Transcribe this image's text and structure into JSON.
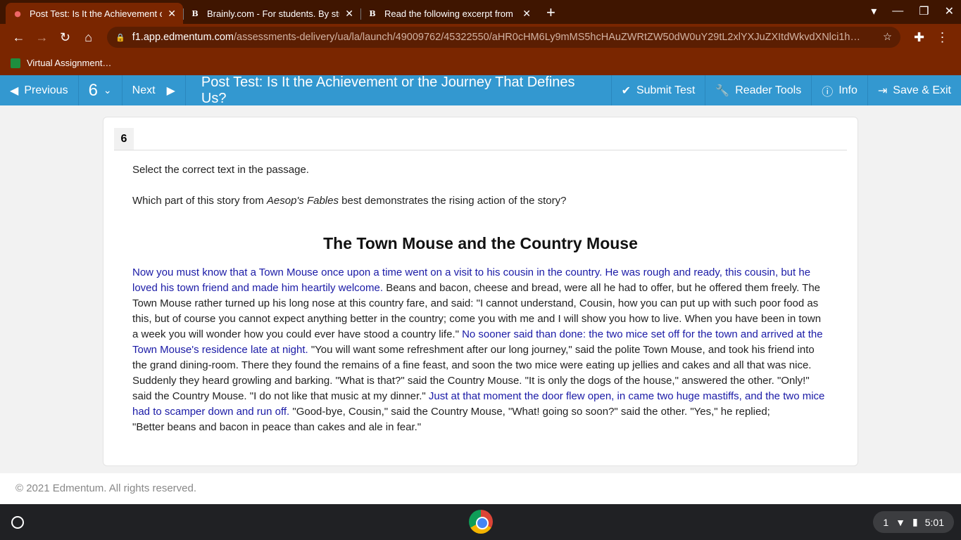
{
  "browser": {
    "tabs": [
      {
        "title": "Post Test: Is It the Achievement or the Journey That Defines Us?",
        "active": true,
        "favicon": "E"
      },
      {
        "title": "Brainly.com - For students. By students.",
        "favicon": "B"
      },
      {
        "title": "Read the following excerpt from",
        "favicon": "B"
      }
    ],
    "url_host": "f1.app.edmentum.com",
    "url_path": "/assessments-delivery/ua/la/launch/49009762/45322550/aHR0cHM6Ly9mMS5hcHAuZWRtZW50dW0uY29tL2xlYXJuZXItdWkvdXNlci1h…",
    "bookmark": "Virtual Assignment…"
  },
  "appbar": {
    "previous": "Previous",
    "question_number": "6",
    "next": "Next",
    "title": "Post Test: Is It the Achievement or the Journey That Defines Us?",
    "submit": "Submit Test",
    "reader_tools": "Reader Tools",
    "info": "Info",
    "save_exit": "Save & Exit"
  },
  "question": {
    "number": "6",
    "instruction": "Select the correct text in the passage.",
    "prompt_before": "Which part of this story from ",
    "prompt_italic": "Aesop's Fables",
    "prompt_after": " best demonstrates the rising action of the story?",
    "passage_title": "The Town Mouse and the Country Mouse",
    "passage": [
      {
        "text": " Now you must know that a Town Mouse once upon a time went on a visit to his cousin in the country. ",
        "selectable": true
      },
      {
        "text": " He was rough and ready, this cousin, but he loved his town friend and made him heartily welcome. ",
        "selectable": true
      },
      {
        "text": " Beans and bacon, cheese and bread, were all he had to offer, but he offered them freely. The Town Mouse rather turned up his long nose at this country fare, and said: \"I cannot understand, Cousin, how you can put up with such poor food as this, but of course you cannot expect anything better in the country; come you with me and I will show you how to live. When you have been in town a week you will wonder how you could ever have stood a country life.\" ",
        "selectable": false
      },
      {
        "text": " No sooner said than done: the two mice set off for the town and arrived at the Town Mouse's residence late at night. ",
        "selectable": true
      },
      {
        "text": " \"You will want some refreshment after our long journey,\" said the polite Town Mouse, and took his friend into the grand dining-room. There they found the remains of a fine feast, and soon the two mice were eating up jellies and cakes and all that was nice. Suddenly they heard growling and barking. \"What is that?\" said the Country Mouse. \"It is only the dogs of the house,\" answered the other. \"Only!\" said the Country Mouse. \"I do not like that music at my dinner.\" ",
        "selectable": false
      },
      {
        "text": " Just at that moment the door flew open, in came two huge mastiffs, and the two mice had to scamper down and run off. ",
        "selectable": true
      },
      {
        "text": " \"Good-bye, Cousin,\" said the Country Mouse, \"What! going so soon?\" said the other. \"Yes,\" he replied;",
        "selectable": false
      }
    ],
    "moral": "\"Better beans and bacon in peace than cakes and ale in fear.\""
  },
  "footer": "© 2021 Edmentum. All rights reserved.",
  "tray": {
    "notifications": "1",
    "time": "5:01"
  }
}
